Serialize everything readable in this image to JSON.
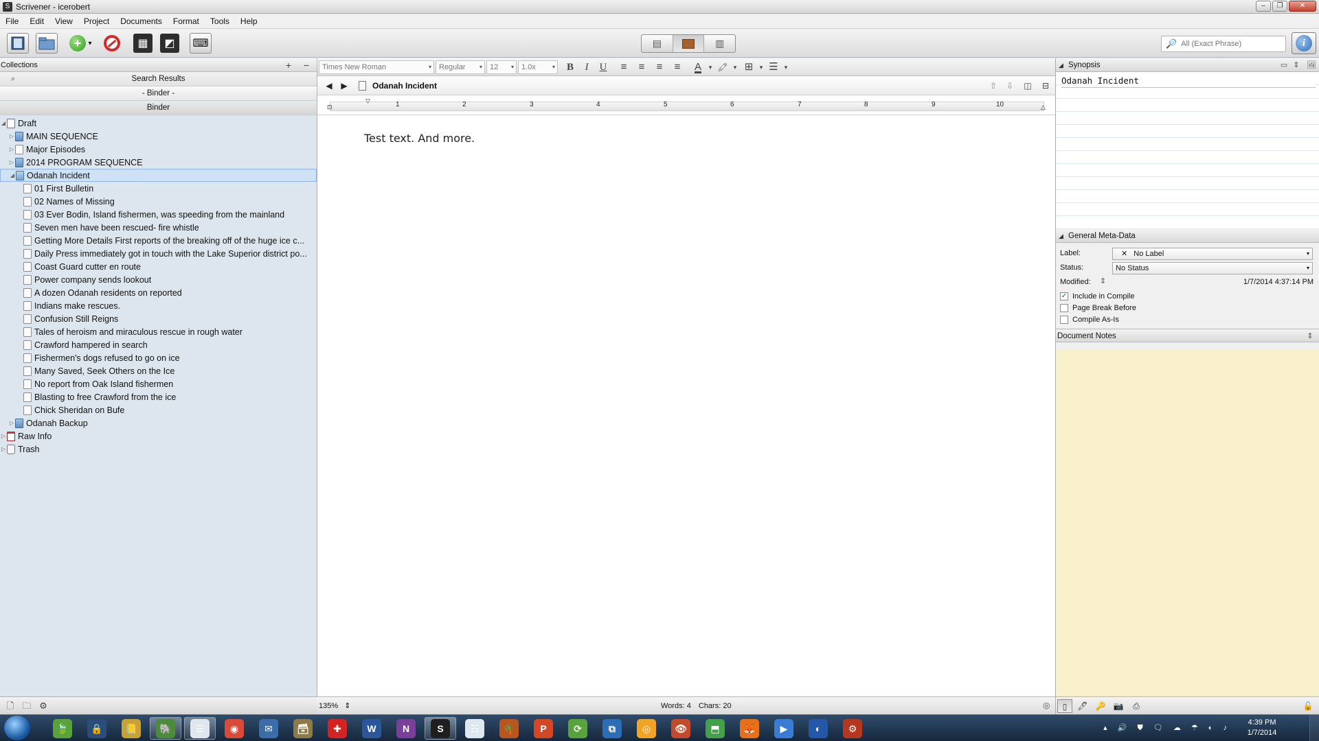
{
  "window": {
    "title": "Scrivener - icerobert",
    "app_icon_glyph": "S",
    "controls": {
      "minimize": "–",
      "maximize": "❐",
      "close": "✕"
    }
  },
  "menu": [
    "File",
    "Edit",
    "View",
    "Project",
    "Documents",
    "Format",
    "Tools",
    "Help"
  ],
  "toolbar": {
    "search_placeholder": "All (Exact Phrase)",
    "search_icon": "🔎",
    "info_glyph": "i",
    "add_glyph": "+",
    "dropdown_glyph": "▾",
    "split_glyph": "▦",
    "key_glyph": "⌨",
    "fullscreen_glyph": "◩",
    "inspector_glyph": "🔧",
    "viewmode": {
      "scrivenings": "▤",
      "outline": "▥"
    }
  },
  "binder": {
    "collections_label": "Collections",
    "add_glyph": "+",
    "remove_glyph": "−",
    "search_glyph": "⌕",
    "tabs": {
      "search": "Search Results",
      "binder_divider": "- Binder -",
      "binder": "Binder"
    },
    "expanded_glyph": "◢",
    "collapsed_glyph": "▷",
    "items": [
      {
        "label": "Draft",
        "indent": 0,
        "expander": "expanded",
        "icon": "draft"
      },
      {
        "label": "MAIN SEQUENCE",
        "indent": 1,
        "expander": "collapsed",
        "icon": "folder"
      },
      {
        "label": "Major Episodes",
        "indent": 1,
        "expander": "collapsed",
        "icon": "doc"
      },
      {
        "label": "2014 PROGRAM SEQUENCE",
        "indent": 1,
        "expander": "collapsed",
        "icon": "folder"
      },
      {
        "label": "Odanah Incident",
        "indent": 1,
        "expander": "expanded",
        "icon": "stack",
        "selected": true
      },
      {
        "label": "01 First Bulletin",
        "indent": 2,
        "icon": "doc"
      },
      {
        "label": "02 Names of Missing",
        "indent": 2,
        "icon": "doc"
      },
      {
        "label": "03 Ever Bodin, Island fishermen, was speeding from the mainland",
        "indent": 2,
        "icon": "doc"
      },
      {
        "label": "Seven men have been rescued- fire whistle",
        "indent": 2,
        "icon": "doc"
      },
      {
        "label": "Getting More Details First reports of the breaking off of the huge ice c...",
        "indent": 2,
        "icon": "doc"
      },
      {
        "label": "Daily Press immediately got in touch with the Lake Superior district po...",
        "indent": 2,
        "icon": "doc"
      },
      {
        "label": "Coast Guard cutter en route",
        "indent": 2,
        "icon": "doc"
      },
      {
        "label": "Power company sends lookout",
        "indent": 2,
        "icon": "doc"
      },
      {
        "label": "A dozen Odanah residents on reported",
        "indent": 2,
        "icon": "doc"
      },
      {
        "label": "Indians make rescues.",
        "indent": 2,
        "icon": "doc"
      },
      {
        "label": "Confusion Still Reigns",
        "indent": 2,
        "icon": "doc"
      },
      {
        "label": "Tales of heroism and miraculous rescue in rough water",
        "indent": 2,
        "icon": "doc"
      },
      {
        "label": "Crawford hampered in search",
        "indent": 2,
        "icon": "doc"
      },
      {
        "label": "Fishermen's dogs refused to go on ice",
        "indent": 2,
        "icon": "doc"
      },
      {
        "label": "Many Saved, Seek Others on the Ice",
        "indent": 2,
        "icon": "doc"
      },
      {
        "label": "No report from Oak Island fishermen",
        "indent": 2,
        "icon": "doc"
      },
      {
        "label": "Blasting to free Crawford from the ice",
        "indent": 2,
        "icon": "doc"
      },
      {
        "label": "Chick Sheridan on Bufe",
        "indent": 2,
        "icon": "doc"
      },
      {
        "label": "Odanah Backup",
        "indent": 1,
        "expander": "collapsed",
        "icon": "folder"
      },
      {
        "label": "Raw Info",
        "indent": 0,
        "expander": "collapsed",
        "icon": "research"
      },
      {
        "label": "Trash",
        "indent": 0,
        "expander": "collapsed",
        "icon": "trash"
      }
    ],
    "footer": {
      "new_doc": "🗋",
      "new_folder": "🗀",
      "settings": "⚙"
    }
  },
  "format_bar": {
    "font": "Times New Roman",
    "style": "Regular",
    "size": "12",
    "spacing": "1.0x",
    "bold": "B",
    "italic": "I",
    "underline": "U",
    "align_left": "≡",
    "align_center": "≡",
    "align_justify": "≡",
    "align_right": "≡",
    "text_color": "A",
    "highlight": "🖍",
    "table": "⊞",
    "list": "☰",
    "arrow": "▾"
  },
  "editor": {
    "back_glyph": "◀",
    "forward_glyph": "▶",
    "doc_title": "Odanah Incident",
    "header_icons": {
      "up": "⇧",
      "down": "⇩",
      "split_v": "◫",
      "split_h": "⊟"
    },
    "ruler_numbers": [
      "1",
      "2",
      "3",
      "4",
      "5",
      "6",
      "7",
      "8",
      "9",
      "10"
    ],
    "text": "Test text. And more.",
    "zoom": "135%",
    "zoom_arrows": "⇕",
    "words": "Words: 4",
    "chars": "Chars: 20",
    "target_glyph": "◎"
  },
  "inspector": {
    "synopsis_label": "Synopsis",
    "synopsis_text": "Odanah Incident",
    "synopsis_icons": {
      "card": "▭",
      "updown": "⇕",
      "image": "🖼"
    },
    "section_caret": "◢",
    "metadata_label": "General Meta-Data",
    "label_caption": "Label:",
    "label_value": "No Label",
    "label_x": "✕",
    "status_caption": "Status:",
    "status_value": "No Status",
    "modified_caption": "Modified:",
    "modified_value": "1/7/2014 4:37:14 PM",
    "modified_sort": "⇕",
    "checks": [
      {
        "label": "Include in Compile",
        "checked": true
      },
      {
        "label": "Page Break Before",
        "checked": false
      },
      {
        "label": "Compile As-Is",
        "checked": false
      }
    ],
    "check_mark": "✓",
    "notes_label": "Document Notes",
    "notes_arrows": "⇕",
    "footer_icons": {
      "notes": "▯",
      "references": "🖊",
      "keywords": "🔑",
      "snapshots": "📷",
      "comments": "⎙",
      "lock": "🔓"
    }
  },
  "taskbar": {
    "apps": [
      "🍃",
      "🔒",
      "📒",
      "🐘",
      "☰",
      "◉",
      "✉",
      "🗃",
      "✚",
      "W",
      "N",
      "S",
      "☷",
      "🌴",
      "P",
      "⟳",
      "⧉",
      "◎",
      "👁",
      "⬒",
      "🦊",
      "▶",
      "◐",
      "⚙"
    ],
    "tray_icons": "▴ 🔊 ⛊ 🗨 ☁ ☂ ◐ ♪",
    "time": "4:39 PM",
    "date": "1/7/2014"
  }
}
